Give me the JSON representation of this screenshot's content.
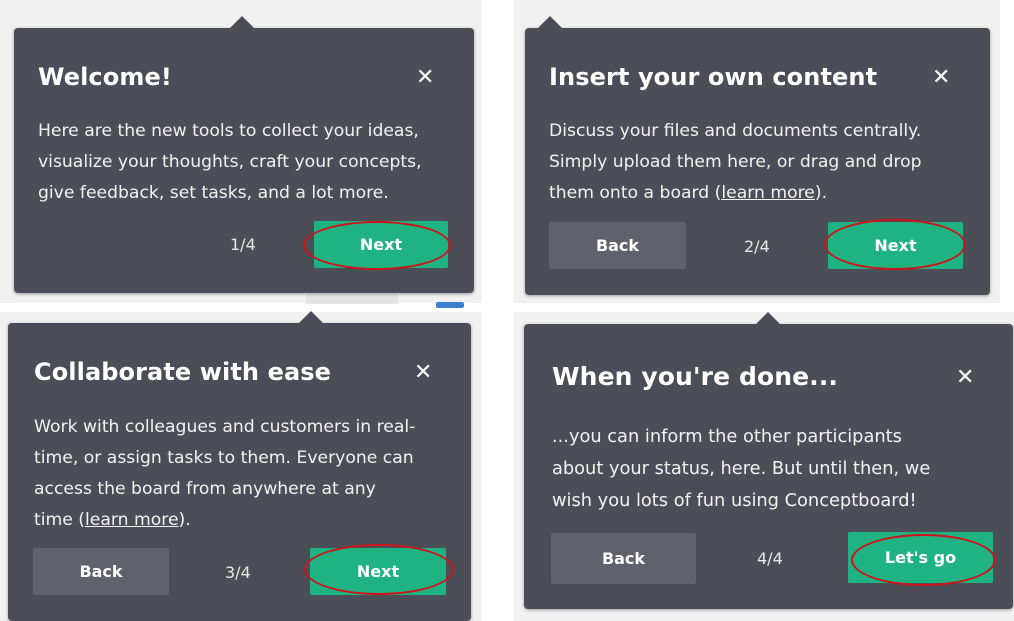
{
  "tips": [
    {
      "title": "Welcome!",
      "body_lines": [
        "Here are the new tools to collect your ideas,",
        "visualize your thoughts, craft your concepts,",
        "give feedback, set tasks, and a lot more."
      ],
      "counter": "1/4",
      "next_label": "Next"
    },
    {
      "title": "Insert your own content",
      "body_lines": [
        "Discuss your files and documents centrally.",
        "Simply upload them here, or drag and drop"
      ],
      "body_last_prefix": "them onto a board (",
      "body_link": "learn more",
      "body_last_suffix": ").",
      "back_label": "Back",
      "counter": "2/4",
      "next_label": "Next"
    },
    {
      "title": "Collaborate with ease",
      "body_lines": [
        "Work with colleagues and customers in real-",
        "time, or assign tasks to them. Everyone can",
        "access the board from anywhere at any"
      ],
      "body_last_prefix": "time (",
      "body_link": "learn more",
      "body_last_suffix": ").",
      "back_label": "Back",
      "counter": "3/4",
      "next_label": "Next"
    },
    {
      "title": "When you're done...",
      "body_lines": [
        "...you can inform the other participants",
        "about your status, here. But until then, we",
        "wish you lots of fun using Conceptboard!"
      ],
      "back_label": "Back",
      "counter": "4/4",
      "next_label": "Let's go"
    }
  ],
  "colors": {
    "tooltip_bg": "#4b4e57",
    "primary_button": "#1fb384",
    "secondary_button": "#5f626b",
    "highlight_ring": "#d0121b"
  },
  "icons": {
    "close": "close-icon"
  }
}
